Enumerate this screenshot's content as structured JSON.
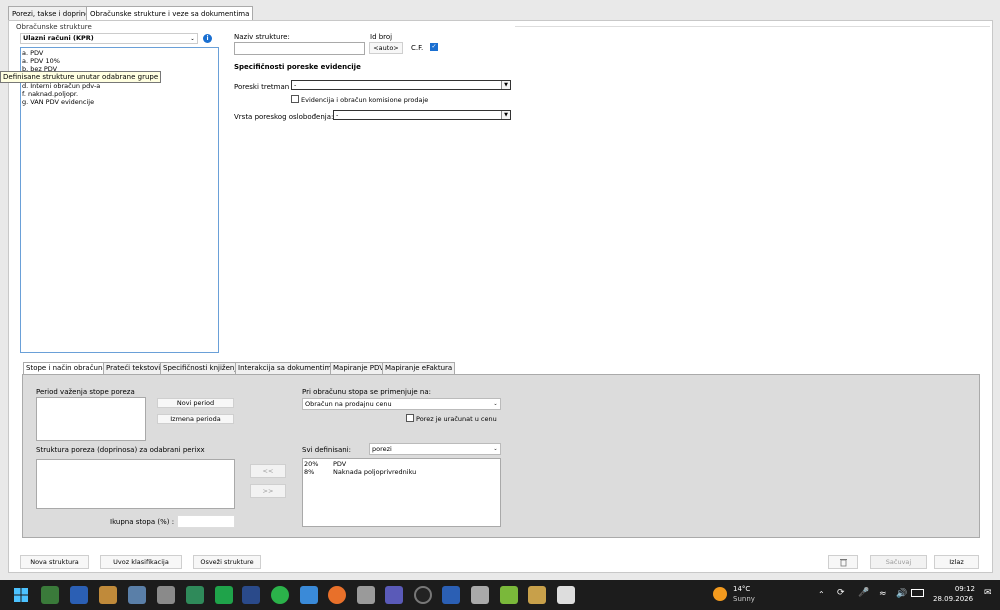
{
  "tabs": [
    "Porezi, takse i doprinosi",
    "Obračunske strukture i veze sa dokumentima"
  ],
  "left": {
    "group_label": "Obračunske strukture",
    "selector_value": "Ulazni računi (KPR)",
    "items": [
      "a. PDV",
      "a. PDV 10%",
      "b. bez PDV",
      "d. Interni obračun pdv-a",
      "f. naknad.poljopr.",
      "g. VAN PDV evidencije"
    ],
    "tooltip": "Definisane strukture unutar odabrane grupe"
  },
  "right": {
    "name_label": "Naziv strukture:",
    "id_label": "Id broj",
    "auto_btn": "<auto>",
    "cf_label": "C.F.",
    "section_title": "Specifičnosti poreske evidencije",
    "tretman_label": "Poreski tretman",
    "tretman_value": "-",
    "komisione_label": "Evidencija i obračun komisione prodaje",
    "oslob_label": "Vrsta poreskog oslobođenja:",
    "oslob_value": "-"
  },
  "subtabs": [
    "Stope i način obračuna",
    "Prateći tekstovi",
    "Specifičnosti knjiženja",
    "Interakcija sa dokumentima",
    "Mapiranje PDV",
    "Mapiranje eFaktura"
  ],
  "panel": {
    "period_label": "Period važenja stope poreza",
    "novi_period": "Novi period",
    "izmena_perioda": "Izmena perioda",
    "struktura_label": "Struktura poreza (doprinosa) za odabrani perixx",
    "left_arrow": "<<",
    "right_arrow": ">>",
    "ukupna_label": "Ikupna stopa (%) :",
    "primenjuje_label": "Pri obračunu stopa se primenjuje na:",
    "primenjuje_value": "Obračun na prodajnu cenu",
    "uracunat_label": "Porez je uračunat u cenu",
    "svi_label": "Svi definisani:",
    "svi_value": "porezi",
    "rates": [
      {
        "rate": "20%",
        "name": "PDV"
      },
      {
        "rate": "8%",
        "name": "Naknada poljoprivredniku"
      }
    ]
  },
  "bottom": {
    "nova": "Nova struktura",
    "uvoz": "Uvoz klasifikacija",
    "osvezi": "Osveži strukture",
    "sacuvaj": "Sačuvaj",
    "izlaz": "Izlaz"
  },
  "taskbar": {
    "temp": "14°C",
    "weather": "Sunny",
    "time": "09:12",
    "date": "28.09.2026"
  }
}
